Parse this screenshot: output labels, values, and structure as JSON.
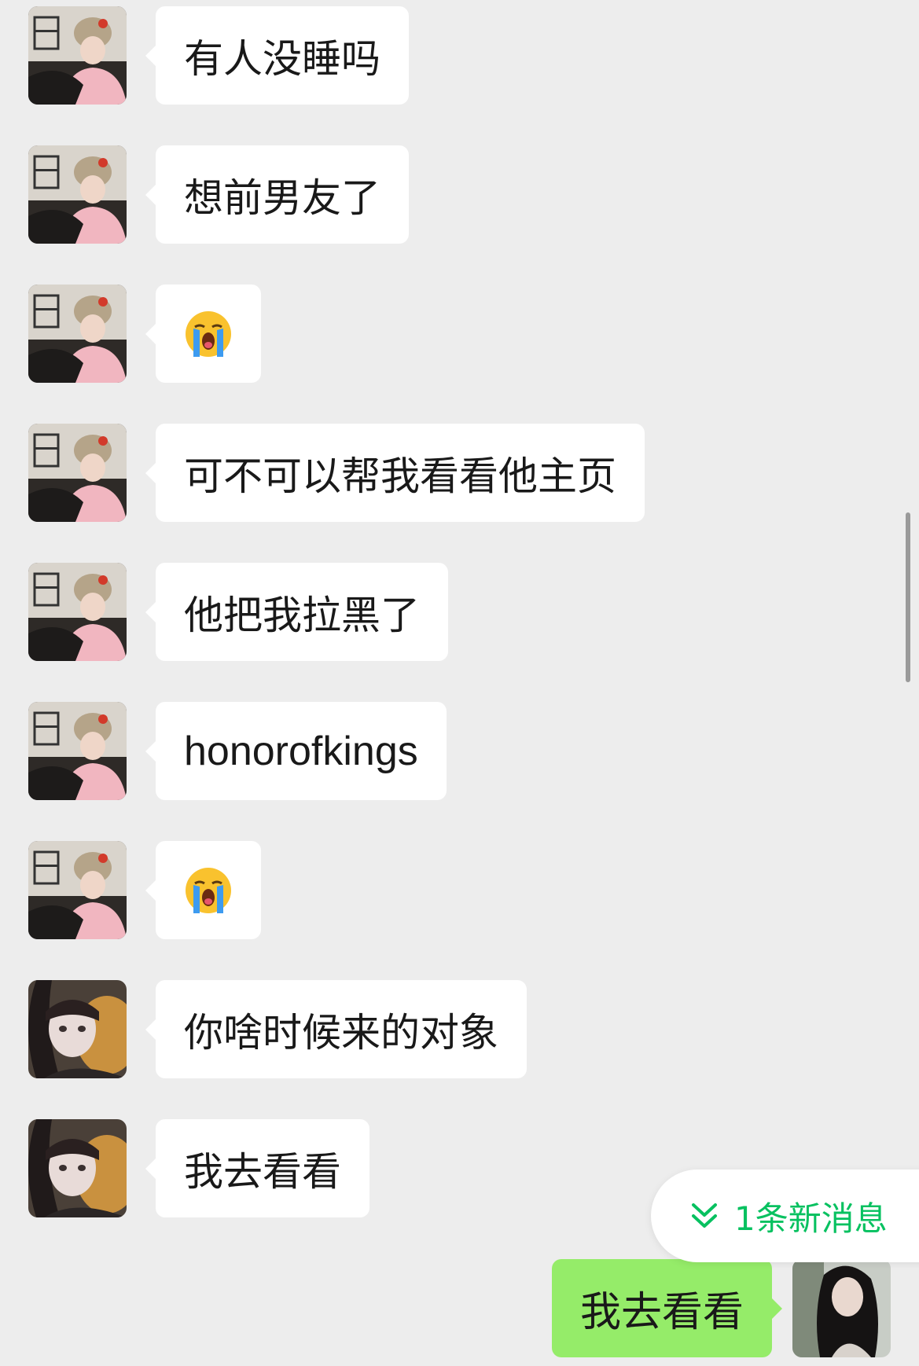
{
  "messages": [
    {
      "sender": "avatar-a",
      "text": "有人没睡吗"
    },
    {
      "sender": "avatar-a",
      "text": "想前男友了"
    },
    {
      "sender": "avatar-a",
      "emoji": "loudly-crying-face"
    },
    {
      "sender": "avatar-a",
      "text": "可不可以帮我看看他主页"
    },
    {
      "sender": "avatar-a",
      "text": "他把我拉黑了"
    },
    {
      "sender": "avatar-a",
      "text": "honorofkings"
    },
    {
      "sender": "avatar-a",
      "emoji": "loudly-crying-face"
    },
    {
      "sender": "avatar-b",
      "text": "你啥时候来的对象"
    },
    {
      "sender": "avatar-b",
      "text": "我去看看"
    }
  ],
  "own_message": {
    "text": "我去看看"
  },
  "new_message_indicator": {
    "label": "1条新消息",
    "icon": "double-chevron-down-icon"
  },
  "colors": {
    "background": "#ededed",
    "bubble": "#ffffff",
    "own_bubble": "#95ec69",
    "accent": "#07c160"
  }
}
